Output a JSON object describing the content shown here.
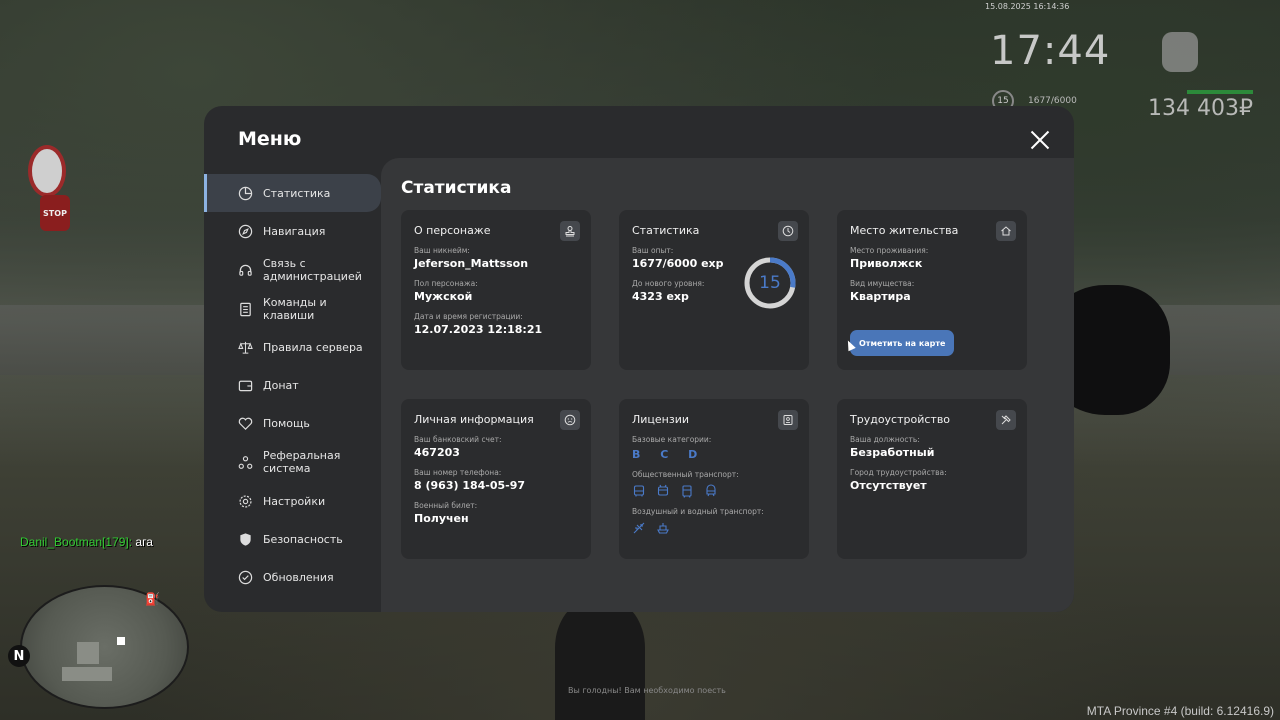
{
  "hud": {
    "timestamp": "15.08.2025 16:14:36",
    "clock": "17:44",
    "level": "15",
    "exp": "1677/6000",
    "money": "134 403₽"
  },
  "chat": {
    "name": "Danil_Bootman[179]:",
    "message": " ага"
  },
  "minimap": {
    "north": "N"
  },
  "bottom_hint": "Вы голодны! Вам необходимо поесть",
  "build": "MTA Province #4 (build: 6.12416.9)",
  "menu": {
    "title": "Меню",
    "nav": [
      {
        "label": "Статистика",
        "icon": "pie-chart-icon",
        "active": true
      },
      {
        "label": "Навигация",
        "icon": "compass-icon"
      },
      {
        "label": "Связь с\nадминистрацией",
        "icon": "headset-icon"
      },
      {
        "label": "Команды и клавиши",
        "icon": "document-icon"
      },
      {
        "label": "Правила сервера",
        "icon": "scales-icon"
      },
      {
        "label": "Донат",
        "icon": "wallet-icon"
      },
      {
        "label": "Помощь",
        "icon": "heart-icon"
      },
      {
        "label": "Реферальная\nсистема",
        "icon": "referral-icon"
      },
      {
        "label": "Настройки",
        "icon": "gear-icon"
      },
      {
        "label": "Безопасность",
        "icon": "shield-icon"
      },
      {
        "label": "Обновления",
        "icon": "update-icon"
      }
    ],
    "content_title": "Статистика",
    "cards": {
      "character": {
        "title": "О персонаже",
        "nickname_label": "Ваш никнейм:",
        "nickname": "Jeferson_Mattsson",
        "gender_label": "Пол персонажа:",
        "gender": "Мужской",
        "reg_label": "Дата и время регистрации:",
        "reg": "12.07.2023 12:18:21"
      },
      "stats": {
        "title": "Статистика",
        "exp_label": "Ваш опыт:",
        "exp": "1677/6000 exp",
        "next_label": "До нового уровня:",
        "next": "4323 exp",
        "level": "15",
        "progress": 0.2795
      },
      "residence": {
        "title": "Место жительства",
        "place_label": "Место проживания:",
        "place": "Приволжск",
        "type_label": "Вид имущества:",
        "type": "Квартира",
        "button": "Отметить на карте"
      },
      "personal": {
        "title": "Личная информация",
        "bank_label": "Ваш банковский счет:",
        "bank": "467203",
        "phone_label": "Ваш номер телефона:",
        "phone": "8 (963) 184-05-97",
        "military_label": "Военный билет:",
        "military": "Получен"
      },
      "licenses": {
        "title": "Лицензии",
        "base_label": "Базовые категории:",
        "base": "B C D",
        "public_label": "Общественный транспорт:",
        "air_label": "Воздушный и водный транспорт:"
      },
      "employment": {
        "title": "Трудоустройство",
        "position_label": "Ваша должность:",
        "position": "Безработный",
        "city_label": "Город трудоустройства:",
        "city": "Отсутствует"
      }
    }
  },
  "colors": {
    "accent": "#4a7ac8",
    "active_bar": "#8db3e2",
    "panel": "#2a2b2d",
    "content": "#363739",
    "card": "#2b2c2e"
  }
}
